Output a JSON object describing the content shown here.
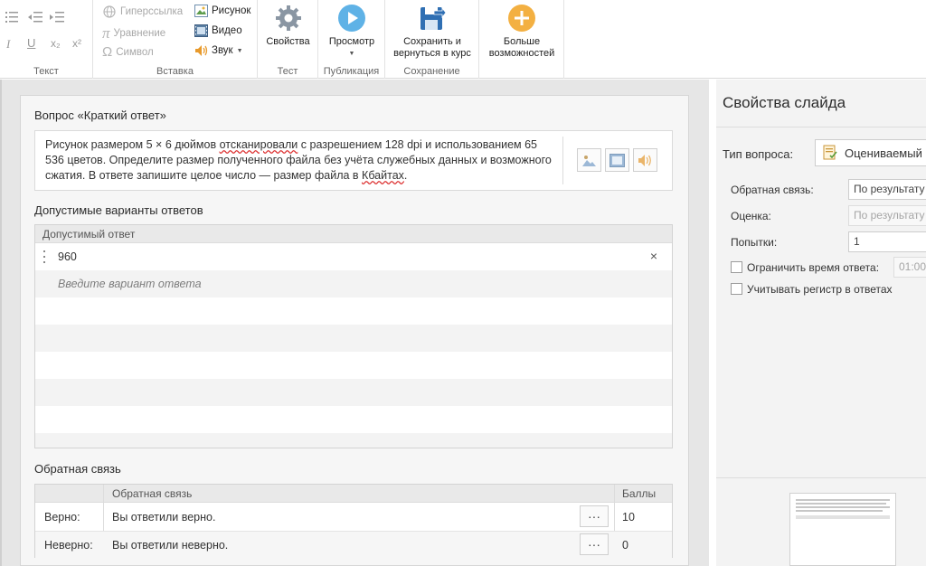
{
  "ribbon": {
    "groups": {
      "text": "Текст",
      "insert": "Вставка",
      "test": "Тест",
      "publish": "Публикация",
      "save": "Сохранение"
    },
    "insert_items": {
      "hyperlink": "Гиперссылка",
      "equation": "Уравнение",
      "symbol": "Символ",
      "picture": "Рисунок",
      "video": "Видео",
      "sound": "Звук"
    },
    "big_buttons": {
      "properties": "Свойства",
      "preview": "Просмотр",
      "save_line1": "Сохранить и",
      "save_line2": "вернуться в курс",
      "more_line1": "Больше",
      "more_line2": "возможностей"
    },
    "format": {
      "italic": "I",
      "underline": "U",
      "subscript": "x₂",
      "superscript": "x²"
    }
  },
  "editor": {
    "question_heading": "Вопрос «Краткий ответ»",
    "question_text": {
      "p1": "Рисунок размером 5 × 6 дюймов ",
      "p2": "отсканировали",
      "p3": " с разрешением 128 dpi и использованием 65 536 цветов. Определите размер полученного файла без учёта служебных данных и возможного сжатия. В ответе запишите целое число — размер файла в ",
      "p4": "Кбайтах",
      "p5": "."
    },
    "answers_heading": "Допустимые варианты ответов",
    "answers_column": "Допустимый ответ",
    "answers": [
      "960"
    ],
    "remove_glyph": "×",
    "answer_placeholder": "Введите вариант ответа",
    "feedback_heading": "Обратная связь",
    "feedback_columns": {
      "feedback": "Обратная связь",
      "points": "Баллы"
    },
    "feedback_rows": [
      {
        "label": "Верно:",
        "text": "Вы ответили верно.",
        "points": "10"
      },
      {
        "label": "Неверно:",
        "text": "Вы ответили неверно.",
        "points": "0"
      }
    ],
    "dots": "···"
  },
  "side": {
    "title": "Свойства слайда",
    "type_label": "Тип вопроса:",
    "type_value": "Оцениваемый",
    "feedback_label": "Обратная связь:",
    "feedback_value": "По результату",
    "score_label": "Оценка:",
    "score_value": "По результату",
    "attempts_label": "Попытки:",
    "attempts_value": "1",
    "limit_time_label": "Ограничить время ответа:",
    "limit_time_value": "01:00",
    "case_label": "Учитывать регистр в ответах"
  },
  "colors": {
    "accent_blue": "#3a9ad9",
    "accent_orange": "#f0a030"
  }
}
